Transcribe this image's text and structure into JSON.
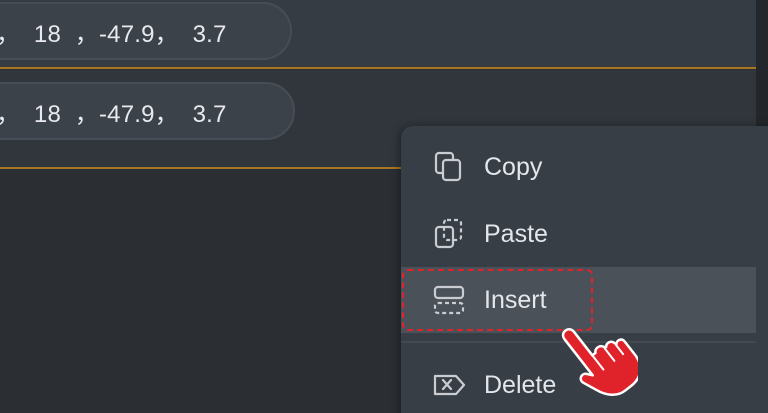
{
  "rows": [
    {
      "text": "，  18  ，-47.9，  3.7"
    },
    {
      "text": "，  18  ，-47.9，  3.7"
    }
  ],
  "context_menu": {
    "items": [
      {
        "label": "Copy",
        "icon": "copy-icon"
      },
      {
        "label": "Paste",
        "icon": "paste-icon"
      },
      {
        "label": "Insert",
        "icon": "insert-row-icon"
      },
      {
        "label": "Delete",
        "icon": "delete-icon"
      }
    ],
    "highlighted": "Insert"
  },
  "colors": {
    "background": "#2b2f34",
    "menu": "#383e45",
    "accent_line": "#a87520",
    "highlight_dash": "#e0232a",
    "pointer": "#e0232a"
  }
}
